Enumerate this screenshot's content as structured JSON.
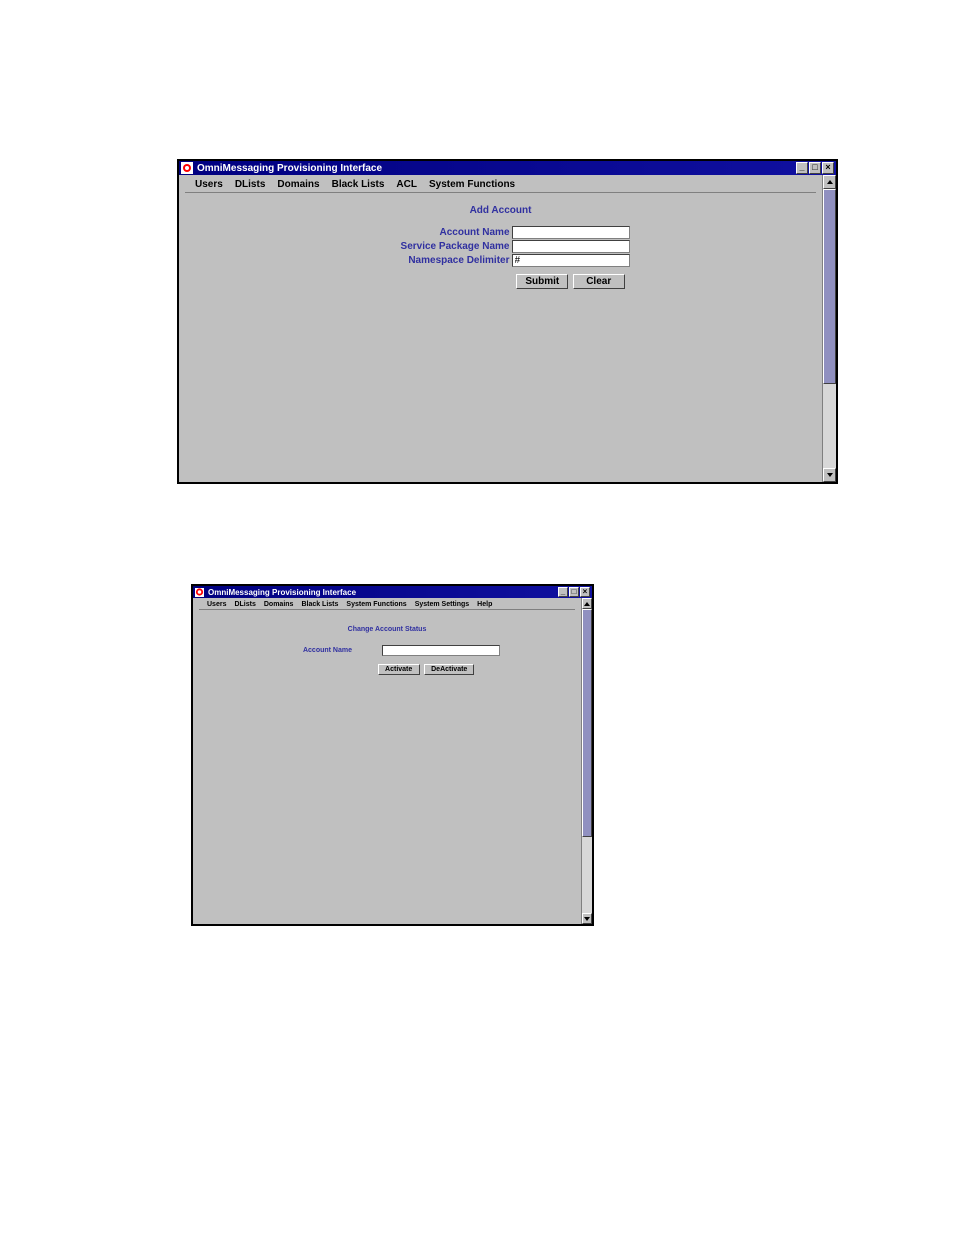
{
  "window1": {
    "title": "OmniMessaging Provisioning Interface",
    "menu": [
      "Users",
      "DLists",
      "Domains",
      "Black Lists",
      "ACL",
      "System Functions"
    ],
    "section_title": "Add Account",
    "fields": {
      "account_name": {
        "label": "Account Name",
        "value": ""
      },
      "service_package_name": {
        "label": "Service Package Name",
        "value": ""
      },
      "namespace_delimiter": {
        "label": "Namespace Delimiter",
        "value": "#"
      }
    },
    "buttons": {
      "submit": "Submit",
      "clear": "Clear"
    },
    "win_controls": {
      "minimize": "_",
      "maximize": "□",
      "close": "×"
    }
  },
  "window2": {
    "title": "OmniMessaging Provisioning Interface",
    "menu": [
      "Users",
      "DLists",
      "Domains",
      "Black Lists",
      "System Functions",
      "System Settings",
      "Help"
    ],
    "section_title": "Change Account Status",
    "fields": {
      "account_name": {
        "label": "Account Name",
        "value": ""
      }
    },
    "buttons": {
      "activate": "Activate",
      "deactivate": "DeActivate"
    },
    "win_controls": {
      "minimize": "_",
      "maximize": "□",
      "close": "×"
    }
  }
}
